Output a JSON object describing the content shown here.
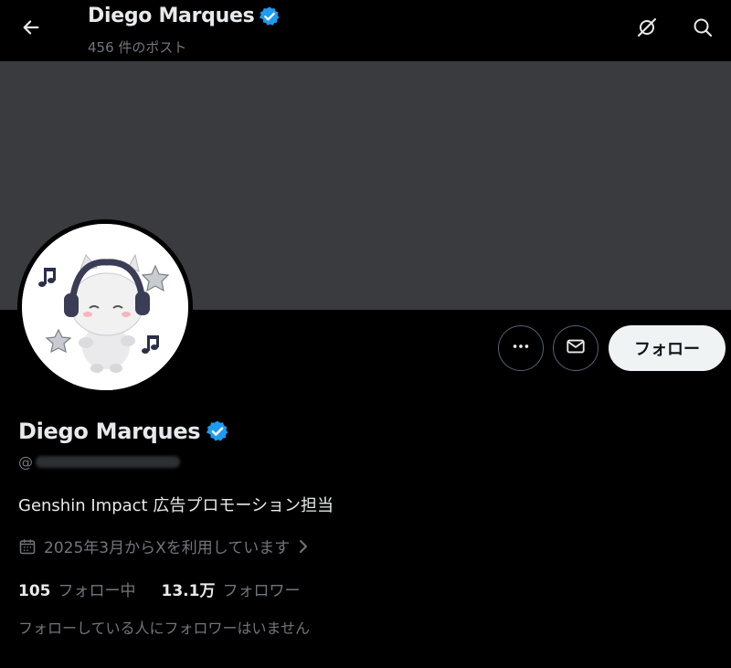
{
  "header": {
    "display_name": "Diego Marques",
    "post_count": "456 件のポスト",
    "icons": [
      "back-arrow-icon",
      "verified-badge-icon",
      "refresh-off-icon",
      "search-icon"
    ]
  },
  "profile": {
    "display_name": "Diego Marques",
    "handle_prefix": "@",
    "bio": "Genshin Impact 広告プロモーション担当",
    "joined": "2025年3月からXを利用しています",
    "following": {
      "count": "105",
      "label": "フォロー中"
    },
    "followers": {
      "count": "13.1万",
      "label": "フォロワー"
    },
    "followers_you_know": "フォローしている人にフォロワーはいません"
  },
  "actions": {
    "follow_label": "フォロー",
    "icons": [
      "more-options-icon",
      "message-icon"
    ]
  },
  "colors": {
    "background": "#000000",
    "banner": "#393b3e",
    "verified": "#1d9bf0",
    "text_primary": "#e7e9ea",
    "text_secondary": "#71767b",
    "follow_button": "#eff3f4"
  }
}
